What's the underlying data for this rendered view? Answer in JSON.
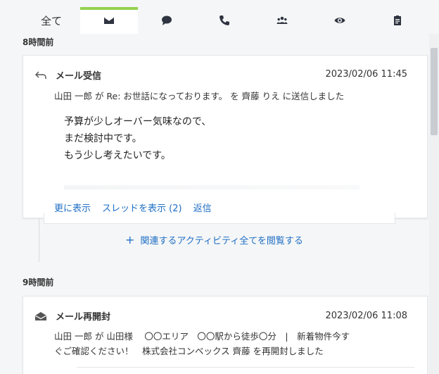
{
  "tabs": [
    {
      "label": "全て",
      "icon": "all-text"
    },
    {
      "label": "",
      "icon": "envelope-icon"
    },
    {
      "label": "",
      "icon": "chat-bubble-icon"
    },
    {
      "label": "",
      "icon": "phone-icon"
    },
    {
      "label": "",
      "icon": "group-icon"
    },
    {
      "label": "",
      "icon": "eye-icon"
    },
    {
      "label": "",
      "icon": "clipboard-icon"
    }
  ],
  "accent_color": "#93d24e",
  "link_color": "#1f6fc5",
  "sections": [
    {
      "label": "8時間前",
      "card": {
        "icon": "reply-icon",
        "title": "メール受信",
        "timestamp": "2023/02/06 11:45",
        "description": "山田 一郎 が Re: お世話になっております。 を 齊藤 りえ に送信しました",
        "body_lines": [
          "予算が少しオーバー気味なので、",
          "まだ検討中です。",
          "もう少し考えたいです。"
        ],
        "links": [
          "更に表示",
          "スレッドを表示 (2)",
          "返信"
        ]
      },
      "related_link": "関連するアクティビティ全てを閲覧する"
    },
    {
      "label": "9時間前",
      "card": {
        "icon": "envelope-open-icon",
        "title": "メール再開封",
        "timestamp": "2023/02/06 11:08",
        "description_line1": "山田 一郎 が 山田様　 〇〇エリア　〇〇駅から徒歩〇分　|　新着物件今す",
        "description_line2": "ぐご確認ください！　株式会社コンベックス 齊藤 を再開封しました"
      }
    }
  ]
}
